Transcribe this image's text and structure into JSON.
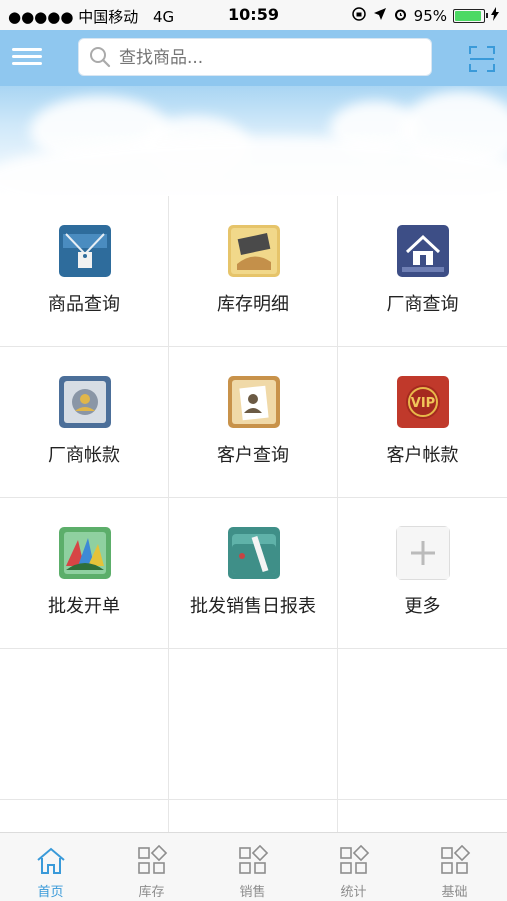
{
  "status_bar": {
    "carrier": "●●●●● 中国移动",
    "network": "4G",
    "time": "10:59",
    "battery": "95%"
  },
  "header": {
    "search_placeholder": "查找商品..."
  },
  "colors": {
    "header_bg": "#8fc7ef",
    "accent": "#3a9ad9",
    "tab_inactive": "#8e8e8e"
  },
  "grid": {
    "items": [
      {
        "label": "商品查询",
        "icon": "product-tag-icon"
      },
      {
        "label": "库存明细",
        "icon": "inventory-money-icon"
      },
      {
        "label": "厂商查询",
        "icon": "house-icon"
      },
      {
        "label": "厂商帐款",
        "icon": "vendor-account-icon"
      },
      {
        "label": "客户查询",
        "icon": "customer-profile-icon"
      },
      {
        "label": "客户帐款",
        "icon": "vip-icon"
      },
      {
        "label": "批发开单",
        "icon": "wholesale-order-icon"
      },
      {
        "label": "批发销售日报表",
        "icon": "sales-report-folder-icon"
      },
      {
        "label": "更多",
        "icon": "plus-icon"
      }
    ]
  },
  "tabbar": {
    "tabs": [
      {
        "label": "首页",
        "icon": "home-icon",
        "active": true
      },
      {
        "label": "库存",
        "icon": "grid-icon"
      },
      {
        "label": "销售",
        "icon": "grid-icon"
      },
      {
        "label": "统计",
        "icon": "grid-icon"
      },
      {
        "label": "基础",
        "icon": "grid-icon"
      }
    ]
  }
}
